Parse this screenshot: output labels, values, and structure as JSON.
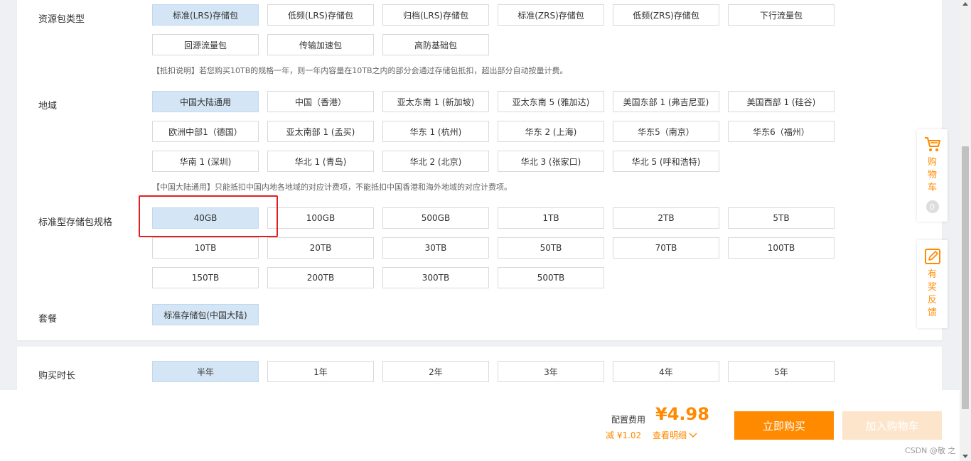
{
  "sections": {
    "resource_type": {
      "label": "资源包类型",
      "options": [
        "标准(LRS)存储包",
        "低频(LRS)存储包",
        "归档(LRS)存储包",
        "标准(ZRS)存储包",
        "低频(ZRS)存储包",
        "下行流量包",
        "回源流量包",
        "传输加速包",
        "高防基础包"
      ],
      "selected": "标准(LRS)存储包",
      "note": "【抵扣说明】若您购买10TB的规格一年，则一年内容量在10TB之内的部分会通过存储包抵扣，超出部分自动按量计费。"
    },
    "region": {
      "label": "地域",
      "options": [
        "中国大陆通用",
        "中国（香港）",
        "亚太东南 1 (新加坡)",
        "亚太东南 5 (雅加达)",
        "美国东部 1 (弗吉尼亚)",
        "美国西部 1 (硅谷)",
        "欧洲中部1（德国）",
        "亚太南部 1 (孟买)",
        "华东 1 (杭州)",
        "华东 2 (上海)",
        "华东5（南京）",
        "华东6（福州）",
        "华南 1 (深圳)",
        "华北 1 (青岛)",
        "华北 2 (北京)",
        "华北 3 (张家口)",
        "华北 5 (呼和浩特)"
      ],
      "selected": "中国大陆通用",
      "note": "【中国大陆通用】只能抵扣中国内地各地域的对应计费项，不能抵扣中国香港和海外地域的对应计费项。"
    },
    "spec": {
      "label": "标准型存储包规格",
      "options": [
        "40GB",
        "100GB",
        "500GB",
        "1TB",
        "2TB",
        "5TB",
        "10TB",
        "20TB",
        "30TB",
        "50TB",
        "70TB",
        "100TB",
        "150TB",
        "200TB",
        "300TB",
        "500TB"
      ],
      "selected": "40GB"
    },
    "package": {
      "label": "套餐",
      "options": [
        "标准存储包(中国大陆)"
      ],
      "selected": "标准存储包(中国大陆)"
    },
    "duration": {
      "label": "购买时长",
      "options": [
        "半年",
        "1年",
        "2年",
        "3年",
        "4年",
        "5年"
      ],
      "selected": "半年"
    }
  },
  "footer": {
    "fee_label": "配置费用",
    "price": "¥4.98",
    "discount": "减 ¥1.02",
    "detail_link": "查看明细",
    "buy_button": "立即购买",
    "cart_button": "加入购物车",
    "watermark": "CSDN @敬 之"
  },
  "side": {
    "cart_label": "购物车",
    "cart_count": "0",
    "feedback_label": "有奖反馈"
  },
  "colors": {
    "accent": "#ff8a00",
    "selected_bg": "#d4e6f5",
    "highlight": "#e02020"
  }
}
